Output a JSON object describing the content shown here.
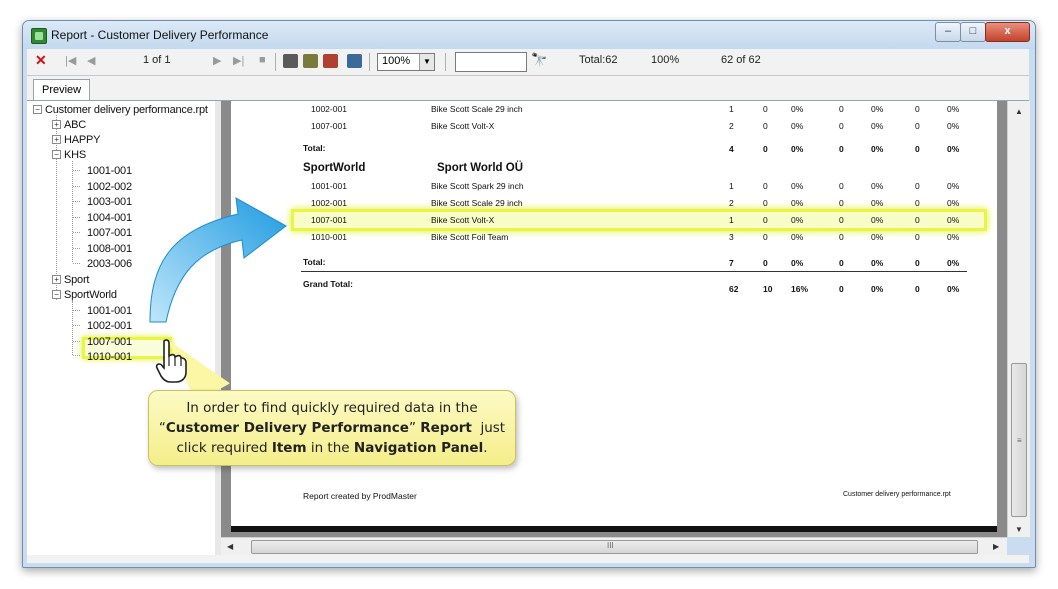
{
  "window": {
    "title": "Report - Customer Delivery Performance",
    "min": "–",
    "max": "□",
    "close": "x"
  },
  "toolbar": {
    "close_glyph": "✕",
    "first_glyph": "|◀",
    "prev_glyph": "◀",
    "page_indicator": "1 of 1",
    "next_glyph": "▶",
    "last_glyph": "▶|",
    "stop_glyph": "■",
    "zoom": "100%",
    "find_glyph": "🔭",
    "total": "Total:62",
    "percent": "100%",
    "progress": "62 of 62"
  },
  "tabs": {
    "preview": "Preview"
  },
  "nav": {
    "root": "Customer delivery performance.rpt",
    "groups": [
      {
        "label": "ABC",
        "expander": "+"
      },
      {
        "label": "HAPPY",
        "expander": "+"
      },
      {
        "label": "KHS",
        "expander": "−"
      },
      {
        "label": "Sport",
        "expander": "+"
      },
      {
        "label": "SportWorld",
        "expander": "−"
      }
    ],
    "khs_items": [
      "1001-001",
      "1002-002",
      "1003-001",
      "1004-001",
      "1007-001",
      "1008-001",
      "2003-006"
    ],
    "sportworld_items": [
      "1001-001",
      "1002-001",
      "1007-001",
      "1010-001"
    ]
  },
  "report": {
    "rows_top": [
      {
        "code": "1002-001",
        "name": "Bike Scott Scale 29 inch",
        "v": [
          "1",
          "0",
          "0%",
          "0",
          "0%",
          "0",
          "0%"
        ]
      },
      {
        "code": "1007-001",
        "name": "Bike Scott Volt-X",
        "v": [
          "2",
          "0",
          "0%",
          "0",
          "0%",
          "0",
          "0%"
        ]
      }
    ],
    "total_label": "Total:",
    "total1": [
      "4",
      "0",
      "0%",
      "0",
      "0%",
      "0",
      "0%"
    ],
    "group_code": "SportWorld",
    "group_name": "Sport World OÜ",
    "rows_group": [
      {
        "code": "1001-001",
        "name": "Bike Scott Spark 29 inch",
        "v": [
          "1",
          "0",
          "0%",
          "0",
          "0%",
          "0",
          "0%"
        ]
      },
      {
        "code": "1002-001",
        "name": "Bike Scott Scale 29 inch",
        "v": [
          "2",
          "0",
          "0%",
          "0",
          "0%",
          "0",
          "0%"
        ]
      },
      {
        "code": "1007-001",
        "name": "Bike Scott Volt-X",
        "v": [
          "1",
          "0",
          "0%",
          "0",
          "0%",
          "0",
          "0%"
        ]
      },
      {
        "code": "1010-001",
        "name": "Bike Scott Foil Team",
        "v": [
          "3",
          "0",
          "0%",
          "0",
          "0%",
          "0",
          "0%"
        ]
      }
    ],
    "total2": [
      "7",
      "0",
      "0%",
      "0",
      "0%",
      "0",
      "0%"
    ],
    "grand_total_label": "Grand Total:",
    "grand_total": [
      "62",
      "10",
      "16%",
      "0",
      "0%",
      "0",
      "0%"
    ],
    "footer_left": "Report created by ProdMaster",
    "footer_right": "Customer delivery performance.rpt"
  },
  "callout": {
    "p1": "In order to find quickly required data in the",
    "q_open": "“",
    "report_name": "Customer Delivery Performance",
    "q_close": "”",
    "report_word": "Report",
    "p2": "just",
    "p3": "click required",
    "item_word": "Item",
    "p4": "in the",
    "panel_word": "Navigation Panel",
    "period": "."
  },
  "scroll": {
    "grip": "≡",
    "hgrip": "III"
  },
  "colors": {
    "highlight": "#e9f542",
    "callout": "#fbf7a4",
    "arrow": "#2ea8e6"
  }
}
